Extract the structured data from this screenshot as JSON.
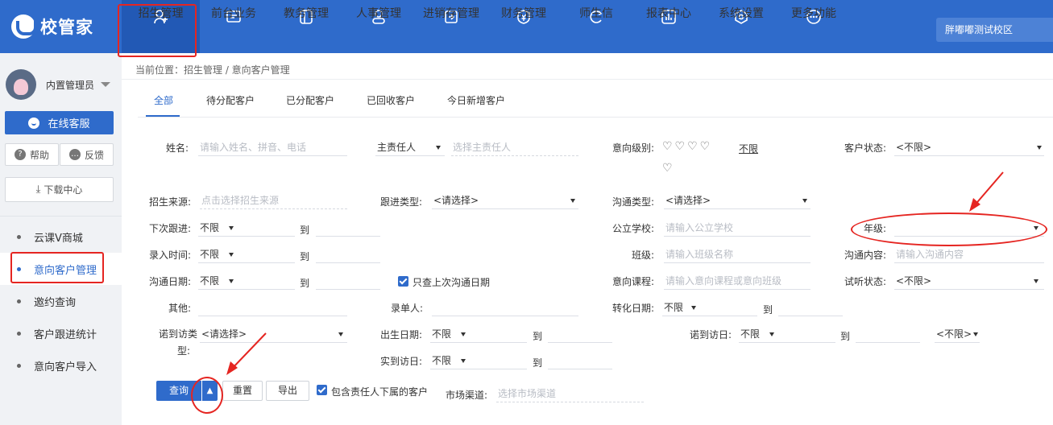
{
  "app": {
    "logo_text": "校管家",
    "school": "胖嘟嘟测试校区"
  },
  "nav": [
    {
      "label": "招生管理",
      "icon": "user-add-icon"
    },
    {
      "label": "前台业务",
      "icon": "monitor-icon"
    },
    {
      "label": "教务管理",
      "icon": "book-icon"
    },
    {
      "label": "人事管理",
      "icon": "person-icon"
    },
    {
      "label": "进销存管理",
      "icon": "inbox-icon"
    },
    {
      "label": "财务管理",
      "icon": "yen-shield-icon"
    },
    {
      "label": "师生信",
      "icon": "chat-circle-icon"
    },
    {
      "label": "报表中心",
      "icon": "bar-chart-icon"
    },
    {
      "label": "系统设置",
      "icon": "gear-icon"
    },
    {
      "label": "更多功能",
      "icon": "more-icon"
    }
  ],
  "sidebar": {
    "user_name": "内置管理员",
    "service_btn": "在线客服",
    "help_btn": "帮助",
    "feedback_btn": "反馈",
    "download_btn": "下载中心",
    "menu": [
      "云课V商城",
      "意向客户管理",
      "邀约查询",
      "客户跟进统计",
      "意向客户导入"
    ]
  },
  "breadcrumb": "当前位置：招生管理 / 意向客户管理",
  "tabs": [
    "全部",
    "待分配客户",
    "已分配客户",
    "已回收客户",
    "今日新增客户"
  ],
  "form": {
    "name_label": "姓名:",
    "name_ph": "请输入姓名、拼音、电话",
    "owner_select": "主责任人",
    "owner_ph": "选择主责任人",
    "intent_level_label": "意向级别:",
    "intent_unlimited": "不限",
    "status_label": "客户状态:",
    "status_value": "<不限>",
    "source_label": "招生来源:",
    "source_ph": "点击选择招生来源",
    "follow_type_label": "跟进类型:",
    "follow_type_value": "<请选择>",
    "comm_type_label": "沟通类型:",
    "comm_type_value": "<请选择>",
    "next_follow_label": "下次跟进:",
    "range_any": "不限",
    "to": "到",
    "public_school_label": "公立学校:",
    "public_school_ph": "请输入公立学校",
    "grade_label": "年级:",
    "entry_time_label": "录入时间:",
    "class_label": "班级:",
    "class_ph": "请输入班级名称",
    "comm_content_label": "沟通内容:",
    "comm_content_ph": "请输入沟通内容",
    "comm_date_label": "沟通日期:",
    "last_comm_only": "只查上次沟通日期",
    "intent_course_label": "意向课程:",
    "intent_course_ph": "请输入意向课程或意向班级",
    "trial_status_label": "试听状态:",
    "trial_status_value": "<不限>",
    "other_label": "其他:",
    "recorder_label": "录单人:",
    "convert_date_label": "转化日期:",
    "visit_type_label_1": "诺到访类",
    "visit_type_label_2": "型:",
    "visit_type_value": "<请选择>",
    "birth_date_label": "出生日期:",
    "promise_visit_label": "诺到访日:",
    "promise_visit_extra": "<不限>",
    "actual_visit_label": "实到访日:",
    "query_btn": "查询",
    "reset_btn": "重置",
    "export_btn": "导出",
    "include_sub": "包含责任人下属的客户",
    "channel_label": "市场渠道:",
    "channel_ph": "选择市场渠道"
  }
}
